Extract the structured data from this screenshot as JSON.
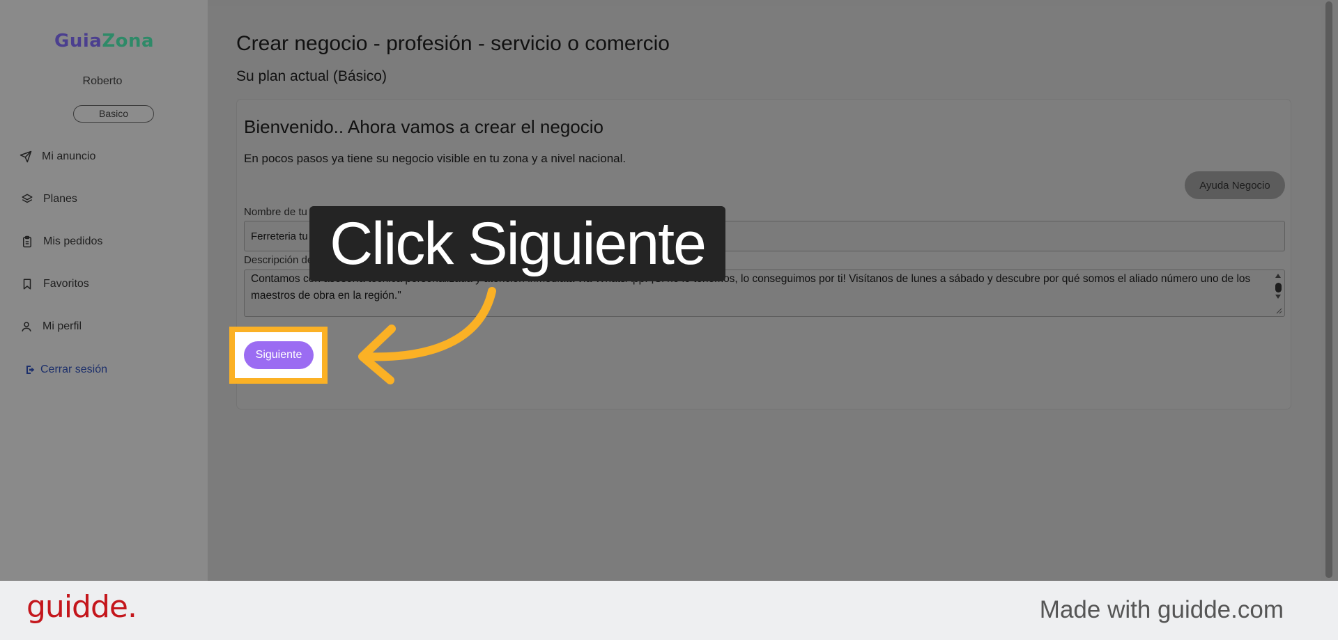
{
  "sidebar": {
    "logo_part1": "Guia",
    "logo_part2": "Zona",
    "user_name": "Roberto",
    "plan_badge": "Basico",
    "items": [
      {
        "label": "Mi anuncio",
        "icon": "send-icon"
      },
      {
        "label": "Planes",
        "icon": "layers-icon"
      },
      {
        "label": "Mis pedidos",
        "icon": "clipboard-icon"
      },
      {
        "label": "Favoritos",
        "icon": "bookmark-icon"
      },
      {
        "label": "Mi perfil",
        "icon": "user-icon"
      }
    ],
    "logout_label": "Cerrar sesión"
  },
  "main": {
    "title": "Crear negocio - profesión - servicio o comercio",
    "plan_line": "Su plan actual (Básico)",
    "card": {
      "title": "Bienvenido.. Ahora vamos a crear el negocio",
      "subtitle": "En pocos pasos ya tiene su negocio visible en tu zona y a nivel nacional.",
      "help_button": "Ayuda Negocio",
      "name_label": "Nombre de tu negocio",
      "name_value": "Ferreteria tu Negocio",
      "desc_label": "Descripción del negocio",
      "desc_value": "Contamos con asesoría técnica personalizada y atención inmediata vía WhatsApp. ¡Si no lo tenemos, lo conseguimos por ti! Visítanos de lunes a sábado y descubre por qué somos el aliado número uno de los maestros de obra en la región.\"",
      "next_button": "Siguiente"
    }
  },
  "tutorial": {
    "callout": "Click Siguiente",
    "accent_color": "#fbb125"
  },
  "footer": {
    "brand": "guidde.",
    "made_with": "Made with guidde.com"
  }
}
